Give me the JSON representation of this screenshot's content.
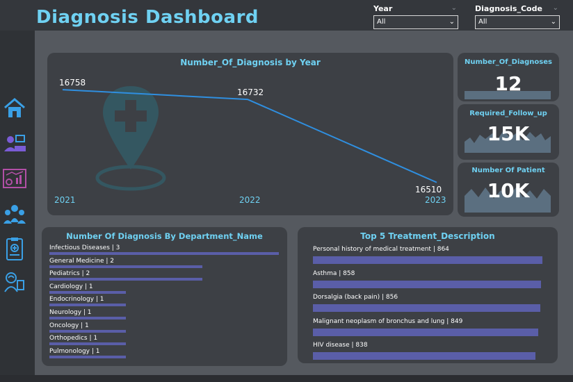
{
  "header": {
    "title": "Diagnosis Dashboard"
  },
  "filters": {
    "year": {
      "label": "Year",
      "value": "All"
    },
    "diagnosis_code": {
      "label": "Diagnosis_Code",
      "value": "All"
    }
  },
  "sidebar": {
    "icons": [
      "home-icon",
      "users-icon",
      "analytics-icon",
      "team-icon",
      "clipboard-icon",
      "doctor-icon"
    ]
  },
  "line_chart": {
    "title": "Number_Of_Diagnosis by Year"
  },
  "kpis": [
    {
      "title": "Number_Of_Diagnoses",
      "value": "12"
    },
    {
      "title": "Required_Follow_up",
      "value": "15K"
    },
    {
      "title": "Number Of Patient",
      "value": "10K"
    }
  ],
  "departments": {
    "title": "Number Of Diagnosis By Department_Name",
    "items": [
      {
        "label": "Infectious Diseases | 3",
        "value": 3
      },
      {
        "label": "General Medicine | 2",
        "value": 2
      },
      {
        "label": "Pediatrics | 2",
        "value": 2
      },
      {
        "label": "Cardiology | 1",
        "value": 1
      },
      {
        "label": "Endocrinology | 1",
        "value": 1
      },
      {
        "label": "Neurology | 1",
        "value": 1
      },
      {
        "label": "Oncology | 1",
        "value": 1
      },
      {
        "label": "Orthopedics | 1",
        "value": 1
      },
      {
        "label": "Pulmonology | 1",
        "value": 1
      }
    ]
  },
  "treatments": {
    "title": "Top 5 Treatment_Description",
    "items": [
      {
        "label": "Personal history of medical treatment | 864",
        "value": 864
      },
      {
        "label": "Asthma | 858",
        "value": 858
      },
      {
        "label": "Dorsalgia (back pain) | 856",
        "value": 856
      },
      {
        "label": "Malignant neoplasm of bronchus and lung | 849",
        "value": 849
      },
      {
        "label": "HIV disease | 838",
        "value": 838
      }
    ]
  },
  "chart_data": {
    "type": "line",
    "title": "Number_Of_Diagnosis by Year",
    "categories": [
      "2021",
      "2022",
      "2023"
    ],
    "series": [
      {
        "values": [
          16758,
          16732,
          16510
        ]
      }
    ],
    "data_labels": [
      "16758",
      "16732",
      "16510"
    ],
    "color": "#2f8fe0",
    "grid": false
  },
  "colors": {
    "accent": "#6fd1f2",
    "bar": "#5a5ea8",
    "line": "#2f8fe0"
  }
}
